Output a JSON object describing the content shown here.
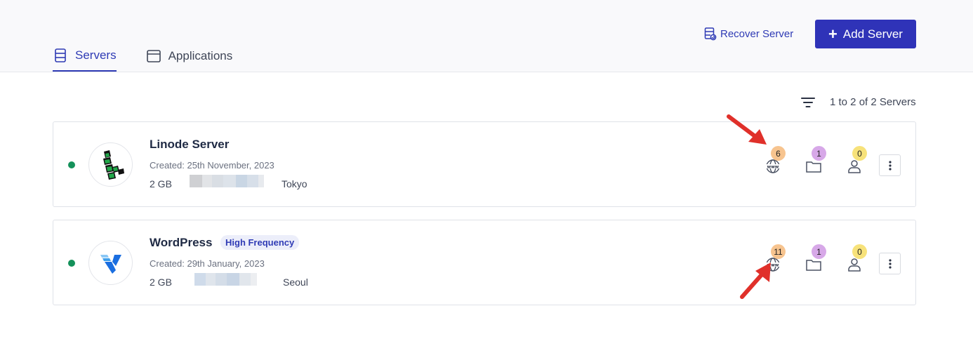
{
  "header": {
    "recover_label": "Recover Server",
    "add_label": "Add Server",
    "accent": "#2f33b8"
  },
  "tabs": [
    {
      "label": "Servers",
      "icon": "server-icon",
      "active": true
    },
    {
      "label": "Applications",
      "icon": "window-icon",
      "active": false
    }
  ],
  "list": {
    "count_label": "1 to 2 of 2 Servers"
  },
  "servers": [
    {
      "name": "Linode Server",
      "tag": "",
      "created": "Created: 25th November, 2023",
      "size": "2 GB",
      "region": "Tokyo",
      "provider_logo": "linode-logo",
      "status_color": "#14915a",
      "sites": "6",
      "folders": "1",
      "users": "0"
    },
    {
      "name": "WordPress",
      "tag": "High Frequency",
      "created": "Created: 29th January, 2023",
      "size": "2 GB",
      "region": "Seoul",
      "provider_logo": "vultr-logo",
      "status_color": "#14915a",
      "sites": "11",
      "folders": "1",
      "users": "0"
    }
  ],
  "badge_colors": {
    "sites": "#f7c48f",
    "folders": "#d7a8e8",
    "users": "#f7e27a"
  }
}
